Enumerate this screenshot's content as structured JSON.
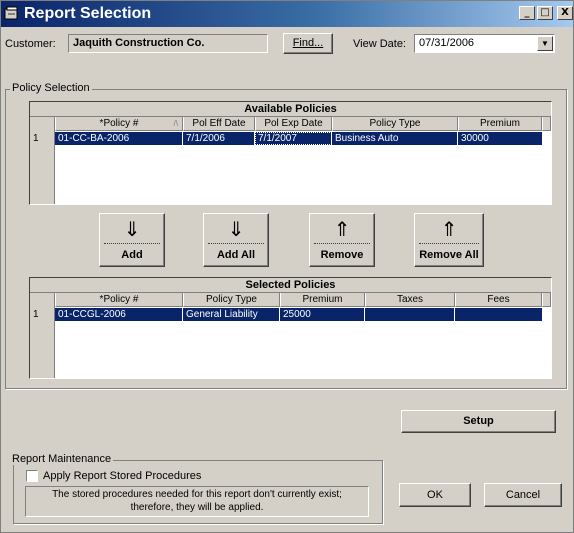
{
  "window": {
    "title": "Report Selection",
    "minimize_label": "_",
    "maximize_label": "□",
    "close_label": "X"
  },
  "customer": {
    "label": "Customer:",
    "value": "Jaquith Construction Co.",
    "find_label": "Find..."
  },
  "view_date": {
    "label": "View Date:",
    "value": "07/31/2006"
  },
  "policy_selection": {
    "title": "Policy Selection",
    "available": {
      "caption": "Available Policies",
      "columns": [
        "*Policy #",
        "Pol Eff Date",
        "Pol Exp Date",
        "Policy Type",
        "Premium"
      ],
      "sort_indicator": "/\\",
      "rows": [
        {
          "num": "1",
          "policy": "01-CC-BA-2006",
          "eff": "7/1/2006",
          "exp": "7/1/2007",
          "type": "Business Auto",
          "premium": "30000"
        }
      ]
    },
    "buttons": {
      "add": "Add",
      "add_all": "Add All",
      "remove": "Remove",
      "remove_all": "Remove All"
    },
    "selected": {
      "caption": "Selected Policies",
      "columns": [
        "*Policy #",
        "Policy Type",
        "Premium",
        "Taxes",
        "Fees"
      ],
      "rows": [
        {
          "num": "1",
          "policy": "01-CCGL-2006",
          "type": "General Liability",
          "premium": "25000",
          "taxes": "",
          "fees": ""
        }
      ]
    }
  },
  "setup_label": "Setup",
  "report_maintenance": {
    "title": "Report Maintenance",
    "checkbox_label": "Apply Report Stored Procedures",
    "checked": false,
    "note_line1": "The stored procedures needed for this report don't currently exist;",
    "note_line2": "therefore, they will be applied."
  },
  "ok_label": "OK",
  "cancel_label": "Cancel",
  "colors": {
    "title_gradient_start": "#0a246a",
    "selection": "#0a246a",
    "face": "#d4d0c8"
  }
}
